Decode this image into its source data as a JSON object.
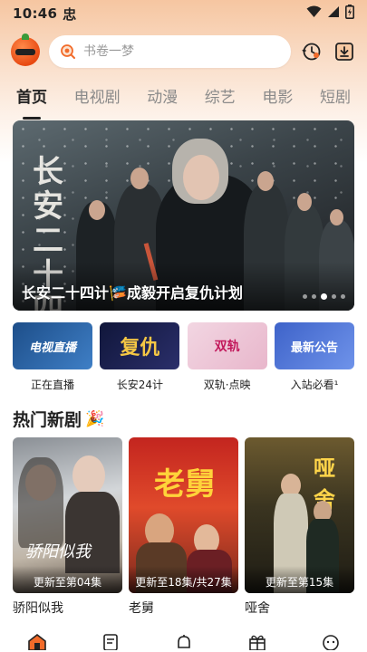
{
  "status_bar": {
    "time": "10:46",
    "app_badge": "忠"
  },
  "search": {
    "placeholder": "书卷一梦"
  },
  "tabs": [
    {
      "label": "首页",
      "active": true
    },
    {
      "label": "电视剧",
      "active": false
    },
    {
      "label": "动漫",
      "active": false
    },
    {
      "label": "综艺",
      "active": false
    },
    {
      "label": "电影",
      "active": false
    },
    {
      "label": "短剧",
      "active": false
    }
  ],
  "banner": {
    "calligraphy": "长安二十四計",
    "caption_title": "长安二十四计",
    "caption_emoji": "🎏",
    "caption_text": "成毅开启复仇计划",
    "dots_total": 5,
    "dots_active_index": 2
  },
  "quick_tiles": [
    {
      "label": "正在直播",
      "art_text": "电视直播"
    },
    {
      "label": "长安24计",
      "art_text": "复仇"
    },
    {
      "label": "双轨·点映",
      "art_text": "双轨"
    },
    {
      "label": "入站必看¹",
      "art_text": "最新公告"
    }
  ],
  "section": {
    "title": "热门新剧",
    "emoji": "🎉"
  },
  "cards": [
    {
      "title": "骄阳似我",
      "badge": "更新至第04集",
      "art_text": "骄阳似我"
    },
    {
      "title": "老舅",
      "badge": "更新至18集/共27集",
      "art_text": "老舅"
    },
    {
      "title": "哑舍",
      "badge": "更新至第15集",
      "art_text": "哑舍"
    }
  ],
  "colors": {
    "accent": "#f26b2a",
    "header_gradient_top": "#f6c6a1",
    "active_tab": "#222222"
  },
  "bottom_nav": [
    "home-icon",
    "list-icon",
    "bell-icon",
    "gift-icon",
    "profile-icon"
  ]
}
